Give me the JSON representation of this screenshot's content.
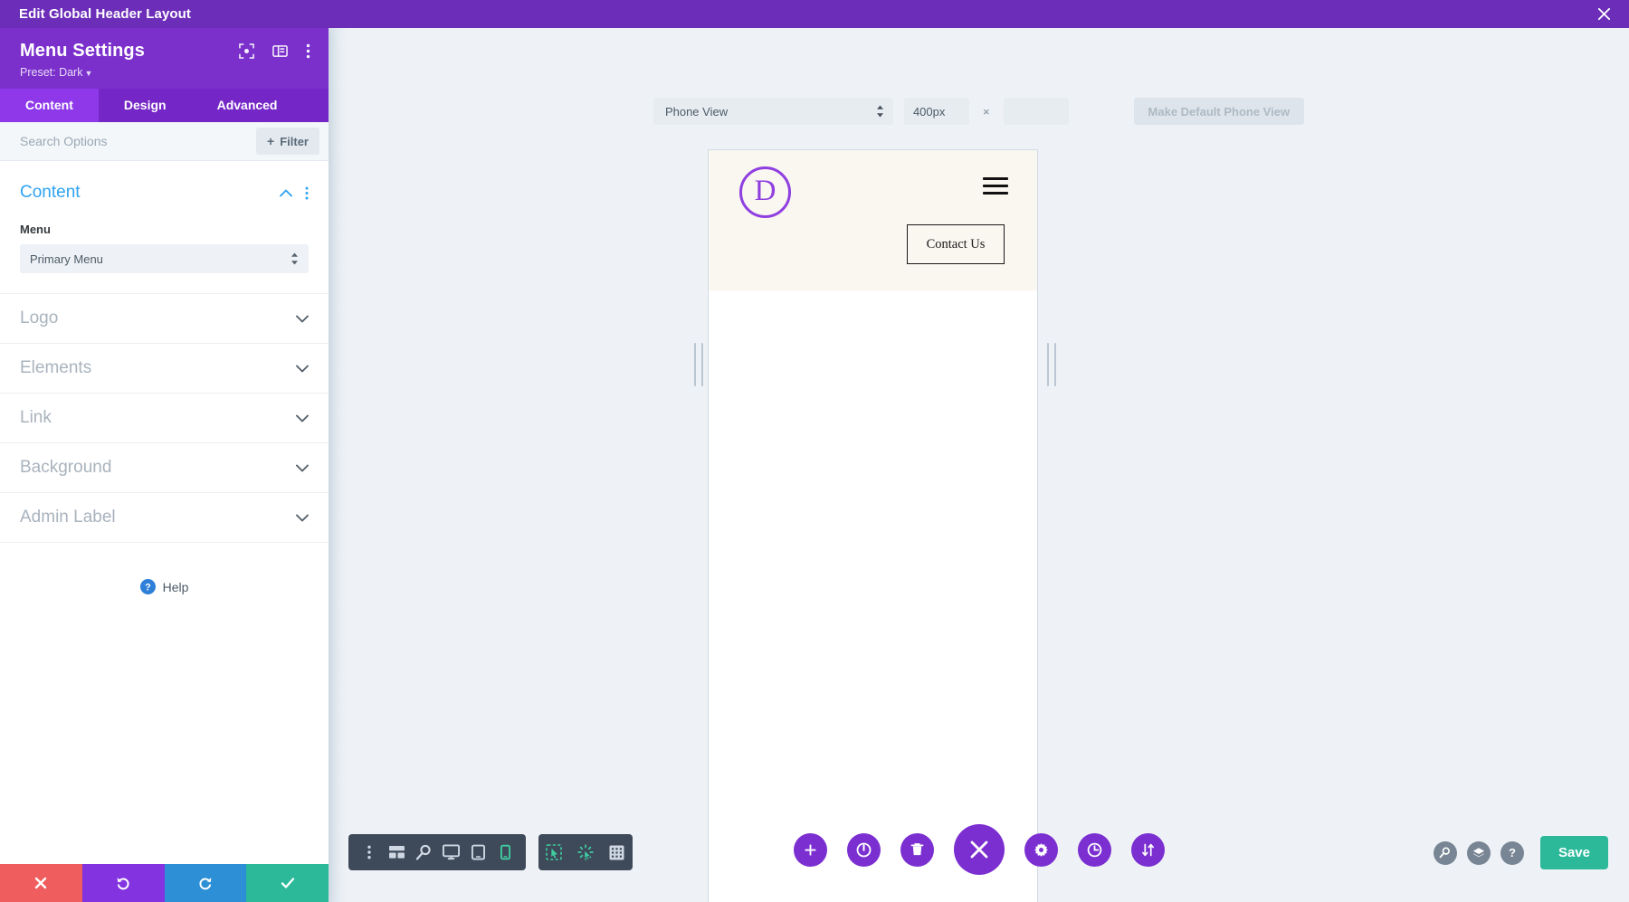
{
  "titlebar": {
    "title": "Edit Global Header Layout",
    "close_icon": "close-icon"
  },
  "panel": {
    "title": "Menu Settings",
    "preset": "Preset: Dark",
    "header_icons": [
      "fullscreen-icon",
      "layout-panel-icon",
      "more-vertical-icon"
    ],
    "tabs": [
      {
        "label": "Content",
        "active": true
      },
      {
        "label": "Design",
        "active": false
      },
      {
        "label": "Advanced",
        "active": false
      }
    ],
    "search": {
      "placeholder": "Search Options",
      "value": ""
    },
    "filter_label": "Filter",
    "open_section": {
      "title": "Content",
      "field_label": "Menu",
      "field_value": "Primary Menu"
    },
    "accordions": [
      {
        "label": "Logo"
      },
      {
        "label": "Elements"
      },
      {
        "label": "Link"
      },
      {
        "label": "Background"
      },
      {
        "label": "Admin Label"
      }
    ],
    "help_label": "Help",
    "footer": [
      {
        "name": "cancel",
        "icon": "close-icon"
      },
      {
        "name": "undo",
        "icon": "undo-icon"
      },
      {
        "name": "redo",
        "icon": "redo-icon"
      },
      {
        "name": "save",
        "icon": "check-icon"
      }
    ]
  },
  "viewbar": {
    "view_mode": "Phone View",
    "width_value": "400px",
    "width_placeholder": "",
    "times": "×",
    "height_value": "",
    "height_placeholder": "",
    "make_default_label": "Make Default Phone View"
  },
  "preview": {
    "logo_letter": "D",
    "logo_color": "#8f3fe0",
    "menu_icon": "hamburger-icon",
    "cta_label": "Contact Us",
    "header_bg": "#faf6f0",
    "body_bg": "#ffffff"
  },
  "bottom_toolbar": {
    "group_a": [
      {
        "name": "more-vertical-icon",
        "active": false
      },
      {
        "name": "wireframe-icon",
        "active": false
      },
      {
        "name": "zoom-out-icon",
        "active": false
      },
      {
        "name": "desktop-icon",
        "active": false
      },
      {
        "name": "tablet-icon",
        "active": false
      },
      {
        "name": "phone-icon",
        "active": true
      }
    ],
    "group_b": [
      {
        "name": "select-area-icon",
        "active": true
      },
      {
        "name": "click-cursor-icon",
        "active": true
      },
      {
        "name": "grid-icon",
        "active": false
      }
    ],
    "round_buttons": [
      {
        "name": "add-icon",
        "big": false
      },
      {
        "name": "power-icon",
        "big": false
      },
      {
        "name": "trash-icon",
        "big": false
      },
      {
        "name": "close-icon",
        "big": true
      },
      {
        "name": "gear-icon",
        "big": false
      },
      {
        "name": "history-icon",
        "big": false
      },
      {
        "name": "sort-icon",
        "big": false
      }
    ],
    "right_tools": [
      {
        "name": "search-icon",
        "label": ""
      },
      {
        "name": "layers-icon",
        "label": ""
      },
      {
        "name": "help-icon",
        "label": "?"
      }
    ],
    "save_label": "Save"
  },
  "colors": {
    "brand_purple": "#7b30cc",
    "title_purple": "#6c2eb9",
    "tab_active": "#8e38ea",
    "accent_blue": "#2ea3f2",
    "save_green": "#2bb99a",
    "cancel_red": "#f05d5e",
    "undo_purple": "#8334e0",
    "redo_blue": "#2d8fd5",
    "canvas_bg": "#eef2f6",
    "toolbar_dark": "#3e4a5a",
    "active_teal": "#3ecfa0"
  }
}
